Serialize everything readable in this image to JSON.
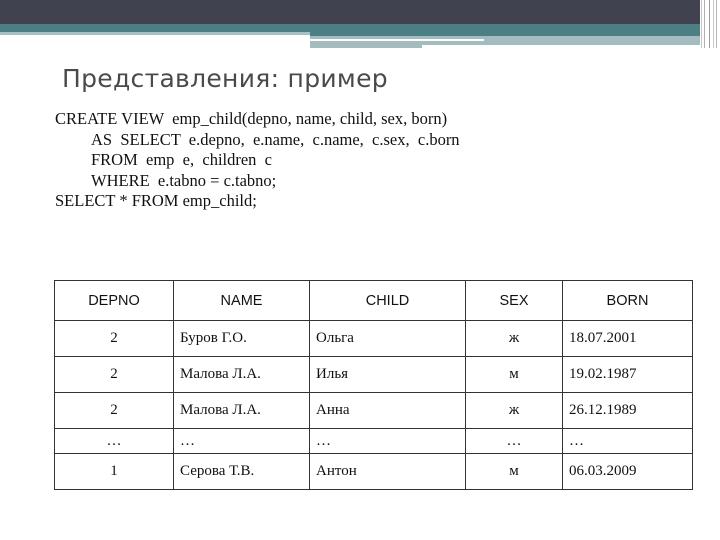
{
  "slide": {
    "title": "Представления: пример",
    "code_lines": [
      "CREATE VIEW  emp_child(depno, name, child, sex, born)",
      "AS  SELECT  e.depno,  e.name,  c.name,  c.sex,  c.born",
      "FROM  emp  e,  children  c",
      "WHERE  e.tabno = c.tabno;",
      "SELECT * FROM emp_child;"
    ],
    "colors": {
      "header_dark": "#40424f",
      "header_teal": "#4b7f83",
      "header_light": "#a4bcbf"
    }
  },
  "table": {
    "columns": [
      "DEPNO",
      "NAME",
      "CHILD",
      "SEX",
      "BORN"
    ],
    "rows": [
      [
        "2",
        "Буров Г.О.",
        "Ольга",
        "ж",
        "18.07.2001"
      ],
      [
        "2",
        "Малова Л.А.",
        "Илья",
        "м",
        "19.02.1987"
      ],
      [
        "2",
        "Малова Л.А.",
        "Анна",
        "ж",
        "26.12.1989"
      ],
      [
        "…",
        "…",
        "…",
        "…",
        "…"
      ],
      [
        "1",
        "Серова Т.В.",
        "Антон",
        "м",
        "06.03.2009"
      ]
    ]
  }
}
